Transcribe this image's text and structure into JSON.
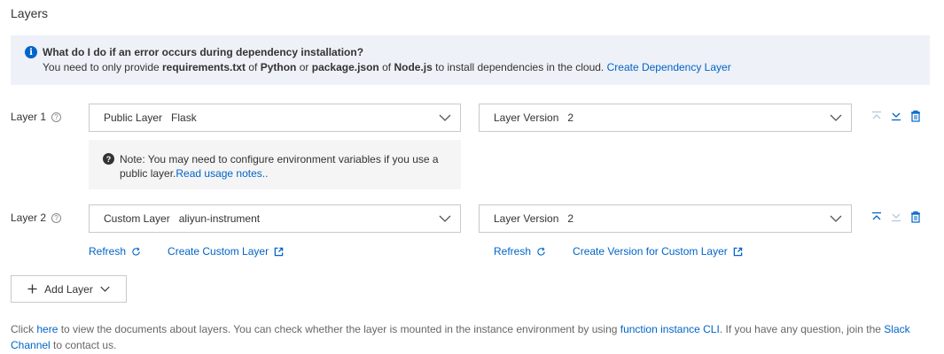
{
  "section": {
    "title": "Layers"
  },
  "info": {
    "title": "What do I do if an error occurs during dependency installation?",
    "t1": "You need to only provide ",
    "b1": "requirements.txt",
    "t2": " of ",
    "b2": "Python",
    "t3": " or ",
    "b3": "package.json",
    "t4": " of ",
    "b4": "Node.js",
    "t5": " to install dependencies in the cloud. ",
    "link": "Create Dependency Layer"
  },
  "layers": [
    {
      "label": "Layer 1",
      "type_key": "Public Layer",
      "type_value": "Flask",
      "version_key": "Layer Version",
      "version_value": "2"
    },
    {
      "label": "Layer 2",
      "type_key": "Custom Layer",
      "type_value": "aliyun-instrument",
      "version_key": "Layer Version",
      "version_value": "2"
    }
  ],
  "note": {
    "text": "Note: You may need to configure environment variables if you use a",
    "text2": "public layer.",
    "link": "Read usage notes.."
  },
  "links": {
    "refresh": "Refresh",
    "create_custom_layer": "Create Custom Layer",
    "create_version": "Create Version for Custom Layer"
  },
  "add_layer": {
    "label": "Add Layer"
  },
  "footer": {
    "t1": "Click ",
    "link1": "here",
    "t2": " to view the documents about layers. You can check whether the layer is mounted in the instance environment by using ",
    "link2": "function instance CLI",
    "t3": ". If you have any question, join the ",
    "link3": "Slack Channel",
    "t4": " to contact us."
  },
  "colors": {
    "link": "#0064c8",
    "info_bg": "#eef1f7",
    "note_bg": "#f5f5f5",
    "border": "#c9c9c9"
  },
  "icons": [
    "info-icon",
    "help-icon",
    "chevron-down-icon",
    "move-top-icon",
    "move-bottom-icon",
    "trash-icon",
    "question-icon",
    "refresh-icon",
    "external-link-icon",
    "plus-icon"
  ]
}
